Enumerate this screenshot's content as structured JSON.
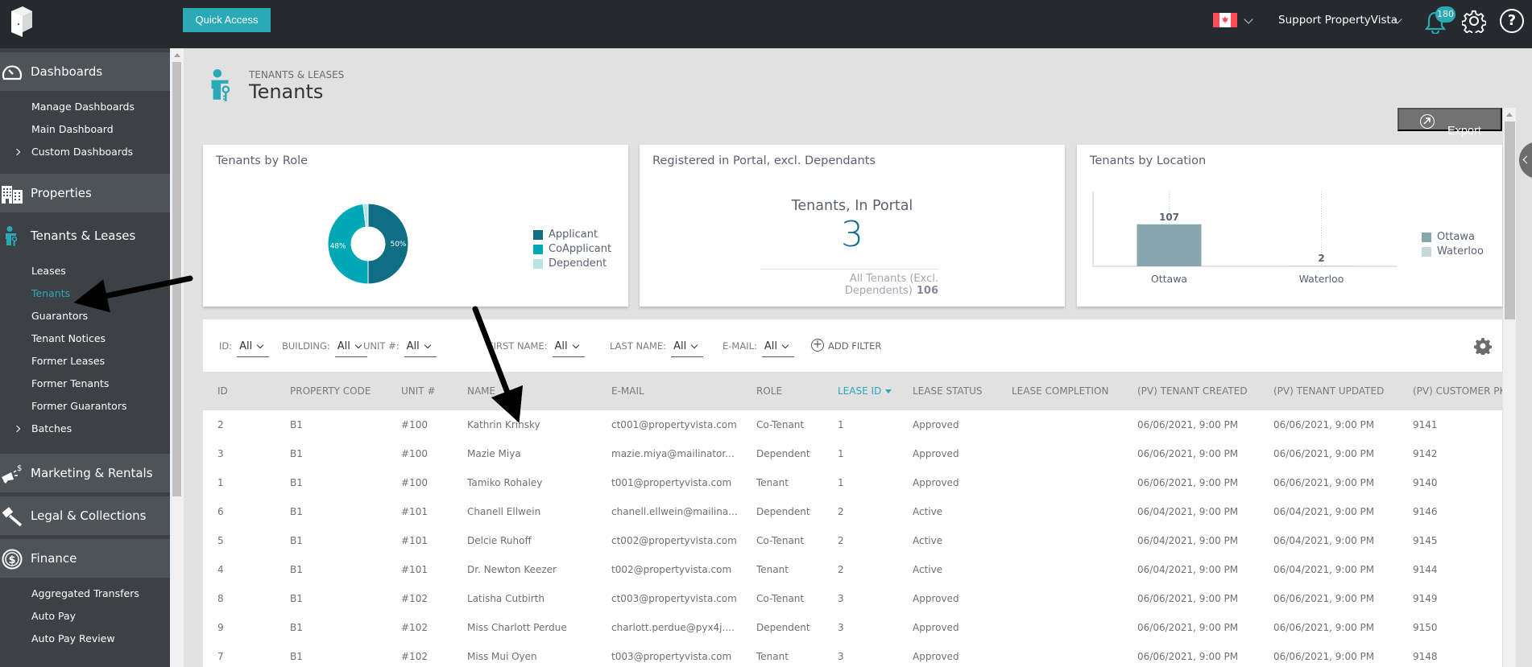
{
  "topbar": {
    "quick_access_label": "Quick Access",
    "user_name": "Support PropertyVista",
    "notification_count": "180",
    "help_label": "?",
    "locale_flag": "canada-flag-icon"
  },
  "sidebar": {
    "sections": [
      {
        "label": "Dashboards",
        "icon": "dashboard-gauge-icon",
        "items": [
          {
            "label": "Manage Dashboards",
            "expandable": false
          },
          {
            "label": "Main Dashboard",
            "expandable": false
          },
          {
            "label": "Custom Dashboards",
            "expandable": true
          }
        ]
      },
      {
        "label": "Properties",
        "icon": "buildings-icon",
        "items": []
      },
      {
        "label": "Tenants & Leases",
        "icon": "tenant-key-icon",
        "items": [
          {
            "label": "Leases",
            "expandable": false
          },
          {
            "label": "Tenants",
            "expandable": false,
            "selected": true
          },
          {
            "label": "Guarantors",
            "expandable": false
          },
          {
            "label": "Tenant Notices",
            "expandable": false
          },
          {
            "label": "Former Leases",
            "expandable": false
          },
          {
            "label": "Former Tenants",
            "expandable": false
          },
          {
            "label": "Former Guarantors",
            "expandable": false
          },
          {
            "label": "Batches",
            "expandable": true
          }
        ]
      },
      {
        "label": "Marketing & Rentals",
        "icon": "megaphone-dollar-icon",
        "items": []
      },
      {
        "label": "Legal & Collections",
        "icon": "gavel-icon",
        "items": []
      },
      {
        "label": "Finance",
        "icon": "dollar-circle-icon",
        "items": [
          {
            "label": "Aggregated Transfers",
            "expandable": false
          },
          {
            "label": "Auto Pay",
            "expandable": false
          },
          {
            "label": "Auto Pay Review",
            "expandable": false
          }
        ]
      }
    ]
  },
  "page": {
    "breadcrumb": "TENANTS & LEASES",
    "title": "Tenants",
    "export_label": "Export"
  },
  "cards": {
    "role": {
      "title": "Tenants by Role"
    },
    "portal": {
      "title": "Registered in Portal, excl. Dependants",
      "kpi_label": "Tenants, In Portal",
      "kpi_value": "3",
      "sub_label": "All Tenants (Excl. Dependents)",
      "sub_value": "106"
    },
    "location": {
      "title": "Tenants by Location"
    }
  },
  "chart_data": [
    {
      "type": "pie",
      "title": "Tenants by Role",
      "donut": true,
      "categories": [
        "Applicant",
        "CoApplicant",
        "Dependent"
      ],
      "values": [
        50,
        48,
        2
      ],
      "data_labels": [
        "50%",
        "48%",
        ""
      ],
      "colors": [
        "#0f6d84",
        "#00a8b5",
        "#b7e3e6"
      ],
      "legend": "right"
    },
    {
      "type": "bar",
      "title": "Tenants by Location",
      "categories": [
        "Ottawa",
        "Waterloo"
      ],
      "values": [
        107,
        2
      ],
      "data_labels": [
        "107",
        "2"
      ],
      "colors": [
        "#87a6ad",
        "#c5dad8"
      ],
      "ylim": [
        0,
        200
      ],
      "grid": "vertical-dotted",
      "legend": "right"
    }
  ],
  "filters": [
    {
      "label": "ID:",
      "value": "All"
    },
    {
      "label": "BUILDING:",
      "value": "All"
    },
    {
      "label": "UNIT #:",
      "value": "All"
    },
    {
      "label": "FIRST NAME:",
      "value": "All"
    },
    {
      "label": "LAST NAME:",
      "value": "All"
    },
    {
      "label": "E-MAIL:",
      "value": "All"
    }
  ],
  "add_filter_label": "ADD FILTER",
  "table": {
    "columns": [
      "ID",
      "PROPERTY CODE",
      "UNIT #",
      "NAME",
      "E-MAIL",
      "ROLE",
      "LEASE ID",
      "LEASE STATUS",
      "LEASE COMPLETION",
      "(PV) TENANT CREATED",
      "(PV) TENANT UPDATED",
      "(PV) CUSTOMER PK"
    ],
    "sorted_column": "LEASE ID",
    "rows": [
      [
        "2",
        "B1",
        "#100",
        "Kathrin Krinsky",
        "ct001@propertyvista.com",
        "Co-Tenant",
        "1",
        "Approved",
        "",
        "06/06/2021, 9:00 PM",
        "06/06/2021, 9:00 PM",
        "9141"
      ],
      [
        "3",
        "B1",
        "#100",
        "Mazie Miya",
        "mazie.miya@mailinator...",
        "Dependent",
        "1",
        "Approved",
        "",
        "06/06/2021, 9:00 PM",
        "06/06/2021, 9:00 PM",
        "9142"
      ],
      [
        "1",
        "B1",
        "#100",
        "Tamiko Rohaley",
        "t001@propertyvista.com",
        "Tenant",
        "1",
        "Approved",
        "",
        "06/06/2021, 9:00 PM",
        "06/06/2021, 9:00 PM",
        "9140"
      ],
      [
        "6",
        "B1",
        "#101",
        "Chanell Ellwein",
        "chanell.ellwein@mailina...",
        "Dependent",
        "2",
        "Active",
        "",
        "06/04/2021, 9:00 PM",
        "06/04/2021, 9:00 PM",
        "9146"
      ],
      [
        "5",
        "B1",
        "#101",
        "Delcie Ruhoff",
        "ct002@propertyvista.com",
        "Co-Tenant",
        "2",
        "Active",
        "",
        "06/04/2021, 9:00 PM",
        "06/04/2021, 9:00 PM",
        "9145"
      ],
      [
        "4",
        "B1",
        "#101",
        "Dr. Newton Keezer",
        "t002@propertyvista.com",
        "Tenant",
        "2",
        "Active",
        "",
        "06/04/2021, 9:00 PM",
        "06/04/2021, 9:00 PM",
        "9144"
      ],
      [
        "8",
        "B1",
        "#102",
        "Latisha Cutbirth",
        "ct003@propertyvista.com",
        "Co-Tenant",
        "3",
        "Approved",
        "",
        "06/06/2021, 9:00 PM",
        "06/06/2021, 9:00 PM",
        "9149"
      ],
      [
        "9",
        "B1",
        "#102",
        "Miss Charlott Perdue",
        "charlott.perdue@pyx4j....",
        "Dependent",
        "3",
        "Approved",
        "",
        "06/06/2021, 9:00 PM",
        "06/06/2021, 9:00 PM",
        "9150"
      ],
      [
        "7",
        "B1",
        "#102",
        "Miss Mui Oyen",
        "t003@propertyvista.com",
        "Tenant",
        "3",
        "Approved",
        "",
        "06/06/2021, 9:00 PM",
        "06/06/2021, 9:00 PM",
        "9148"
      ]
    ]
  },
  "colors": {
    "accent": "#2aa9b7",
    "topbar_bg": "#26292e",
    "sidebar_bg": "#3d4045",
    "sidebar_section_bg": "#4e5358",
    "kpi_value": "#0f6d84"
  }
}
